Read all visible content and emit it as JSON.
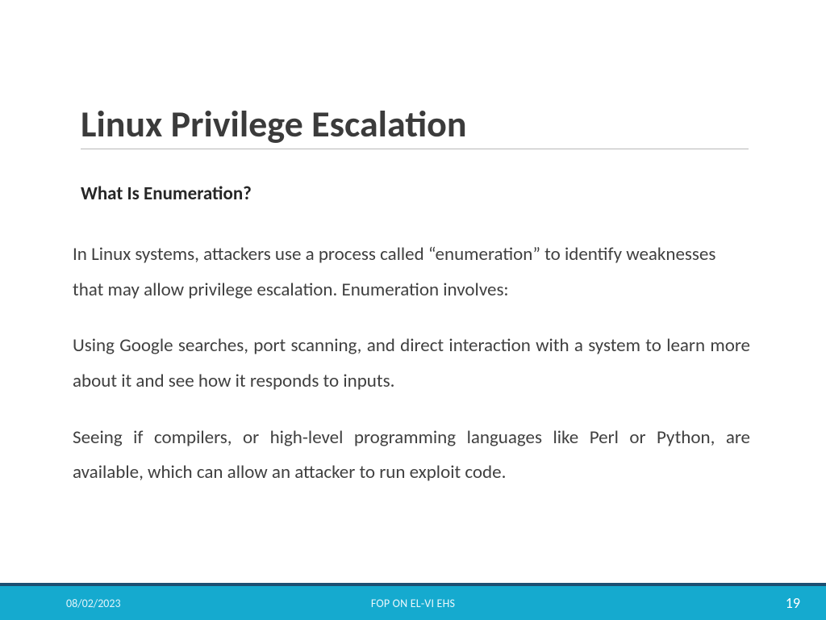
{
  "title": "Linux Privilege Escalation",
  "subheading": "What Is Enumeration?",
  "paragraphs": [
    "In Linux systems, attackers use a process called “enumeration” to identify weaknesses that may allow privilege escalation. Enumeration involves:",
    "Using Google searches, port scanning, and direct interaction with a system to learn more about it and see how it responds to inputs.",
    "Seeing if compilers, or high-level programming languages like Perl or Python, are available, which can allow an attacker to run exploit code."
  ],
  "footer": {
    "date": "08/02/2023",
    "mid": "FOP ON EL-VI EHS",
    "page": "19"
  }
}
